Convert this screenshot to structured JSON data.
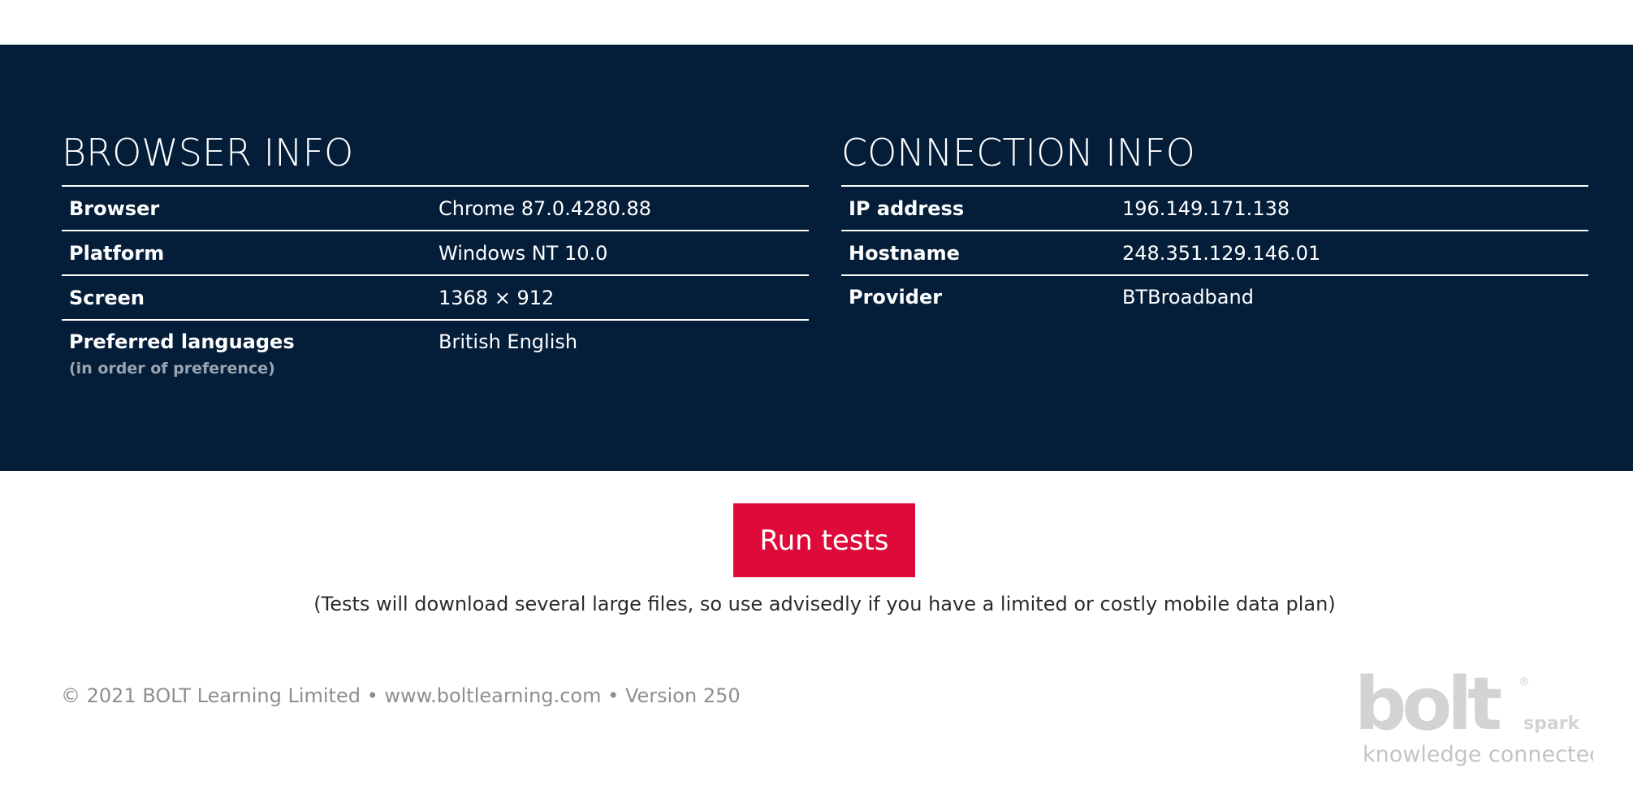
{
  "browser_info": {
    "title": "BROWSER INFO",
    "rows": [
      {
        "label": "Browser",
        "value": "Chrome 87.0.4280.88"
      },
      {
        "label": "Platform",
        "value": "Windows NT 10.0"
      },
      {
        "label": "Screen",
        "value": "1368 × 912"
      },
      {
        "label": "Preferred languages",
        "sublabel": "(in order of preference)",
        "value": "British English"
      }
    ]
  },
  "connection_info": {
    "title": "CONNECTION INFO",
    "rows": [
      {
        "label": "IP address",
        "value": "196.149.171.138"
      },
      {
        "label": "Hostname",
        "value": "248.351.129.146.01"
      },
      {
        "label": "Provider",
        "value": "BTBroadband"
      }
    ]
  },
  "run_button": {
    "label": "Run tests"
  },
  "note": "(Tests will download several large files, so use advisedly if you have a limited or costly mobile data plan)",
  "footer": {
    "copyright": "© 2021 BOLT Learning Limited",
    "separator": "•",
    "website": "www.boltlearning.com",
    "version": "Version 250"
  },
  "logo": {
    "wordmark": "bolt",
    "registered": "®",
    "product": "spark",
    "tagline": "knowledge connected"
  },
  "colors": {
    "band_background": "#041e3a",
    "button": "#de0a3a",
    "footer_text": "#8e8e8e",
    "logo_gray": "#d3d3d3"
  }
}
